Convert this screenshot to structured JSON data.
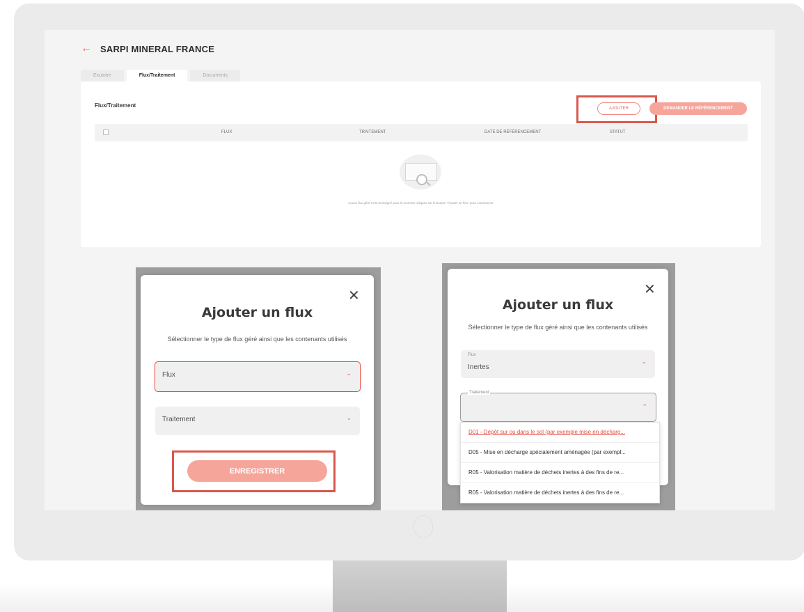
{
  "header": {
    "back_symbol": "←",
    "company": "SARPI MINERAL FRANCE"
  },
  "tabs": [
    "Exutoire",
    "Flux/Traitement",
    "Documents"
  ],
  "card": {
    "title": "Flux/Traitement",
    "add_button": "AJOUTER",
    "request_button": "DEMANDER LE RÉFÉRENCEMENT",
    "columns": [
      "FLUX",
      "TRAITEMENT",
      "DATE DE RÉFÉRENCEMENT",
      "STATUT"
    ],
    "empty_message": "Aucun flux géré n'est renseigné pour le moment. Cliquez sur le bouton \"Ajouter un flux\" pour commencer"
  },
  "modal_left": {
    "close": "✕",
    "title": "Ajouter un flux",
    "subtitle": "Sélectionner le type de flux géré ainsi que les contenants utilisés",
    "flux_placeholder": "Flux",
    "traitement_placeholder": "Traitement",
    "save_button": "ENREGISTRER"
  },
  "modal_right": {
    "close": "✕",
    "title": "Ajouter un flux",
    "subtitle": "Sélectionner le type de flux géré ainsi que les contenants utilisés",
    "flux_label": "Flux",
    "flux_value": "Inertes",
    "traitement_label": "Traitement",
    "options": [
      "D01 - Dépôt sur ou dans le sol (par exemple mise en décharg...",
      "D05 - Mise en décharge spécialement aménagée (par exempl...",
      "R05 - Valorisation matière de déchets inertes à des fins de re...",
      "R05 - Valorisation matière de déchets inertes à des fins de re..."
    ]
  },
  "icons": {
    "chevron_down": "⌄",
    "chevron_up": "⌃"
  },
  "colors": {
    "accent": "#f16a5c",
    "highlight": "#d9574c",
    "button_fill": "#f6a59b"
  }
}
